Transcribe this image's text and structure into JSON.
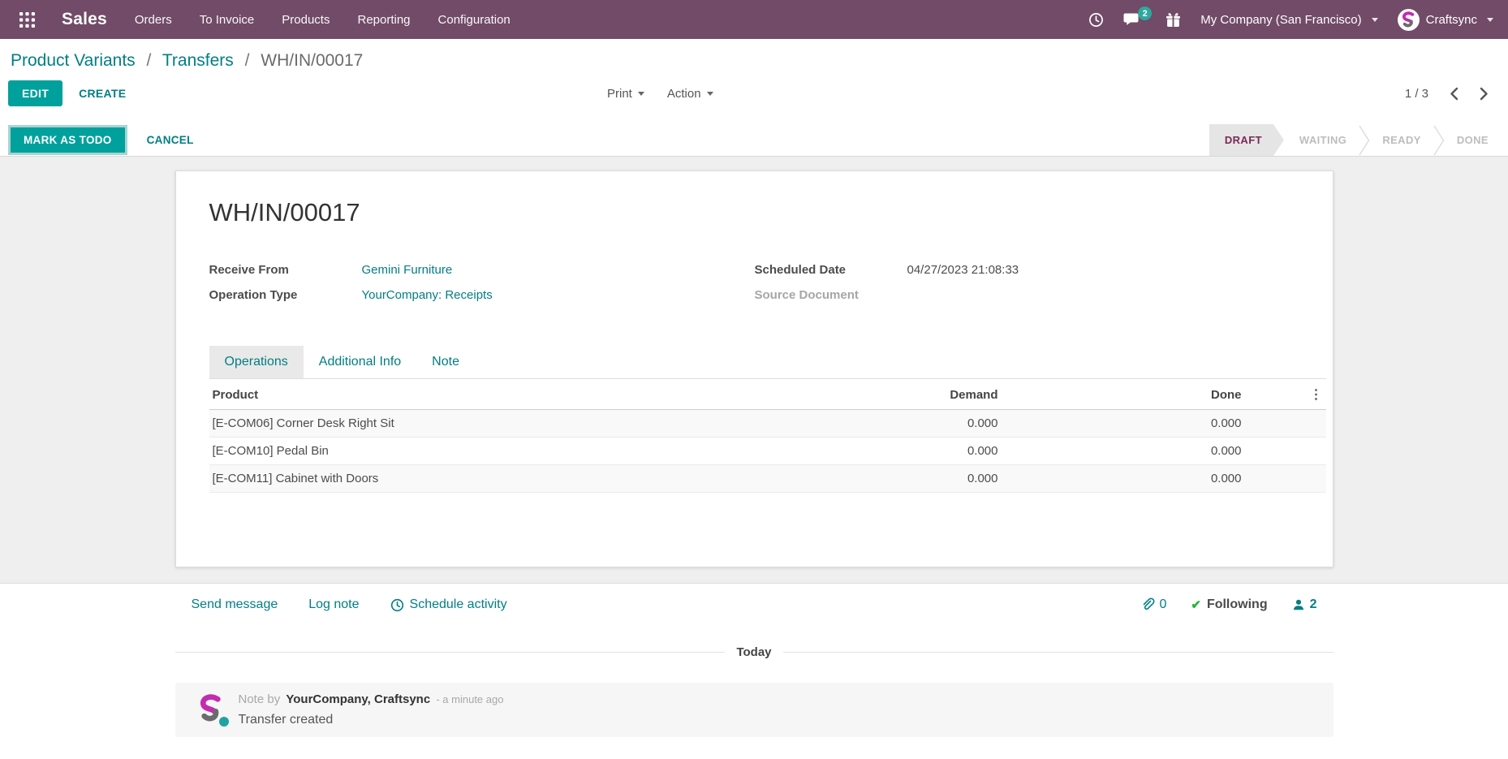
{
  "colors": {
    "brand_purple": "#714B67",
    "accent_teal": "#017e84",
    "button_teal": "#00A09D",
    "badge_teal": "#2EA89E",
    "draft_state_text": "#7A2858",
    "following_green": "#21B632",
    "logo_magenta": "#C32BB0"
  },
  "topbar": {
    "app_name": "Sales",
    "menus": [
      "Orders",
      "To Invoice",
      "Products",
      "Reporting",
      "Configuration"
    ],
    "message_badge": "2",
    "company": "My Company (San Francisco)",
    "user": "Craftsync"
  },
  "breadcrumb": {
    "link1": "Product Variants",
    "link2": "Transfers",
    "current": "WH/IN/00017",
    "separator": "/"
  },
  "control": {
    "edit": "EDIT",
    "create": "CREATE",
    "print": "Print",
    "action": "Action",
    "pager": "1 / 3"
  },
  "statusbar": {
    "mark_as_todo": "MARK AS TODO",
    "cancel": "CANCEL",
    "states": [
      "DRAFT",
      "WAITING",
      "READY",
      "DONE"
    ],
    "active_state": "DRAFT"
  },
  "form": {
    "title": "WH/IN/00017",
    "receive_from_label": "Receive From",
    "receive_from_value": "Gemini Furniture",
    "operation_type_label": "Operation Type",
    "operation_type_value": "YourCompany: Receipts",
    "scheduled_date_label": "Scheduled Date",
    "scheduled_date_value": "04/27/2023 21:08:33",
    "source_document_label": "Source Document",
    "tabs": [
      "Operations",
      "Additional Info",
      "Note"
    ],
    "active_tab": "Operations",
    "table": {
      "col_product": "Product",
      "col_demand": "Demand",
      "col_done": "Done",
      "options_icon": "⋮",
      "rows": [
        {
          "product": "[E-COM06] Corner Desk Right Sit",
          "demand": "0.000",
          "done": "0.000"
        },
        {
          "product": "[E-COM10] Pedal Bin",
          "demand": "0.000",
          "done": "0.000"
        },
        {
          "product": "[E-COM11] Cabinet with Doors",
          "demand": "0.000",
          "done": "0.000"
        }
      ]
    }
  },
  "chatter": {
    "send_message": "Send message",
    "log_note": "Log note",
    "schedule_activity": "Schedule activity",
    "attachment_count": "0",
    "following": "Following",
    "check_glyph": "✔",
    "follower_count": "2",
    "day_divider": "Today",
    "message": {
      "prefix": "Note by",
      "author": "YourCompany, Craftsync",
      "time": "- a minute ago",
      "body": "Transfer created"
    }
  }
}
